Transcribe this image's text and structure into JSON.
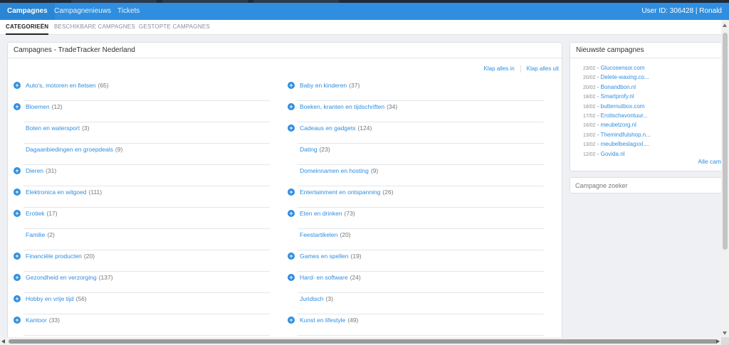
{
  "topnav": {
    "tabs": [
      "Campagnes",
      "Campagnenieuws",
      "Tickets"
    ],
    "user": "User ID: 306428 | Ronald"
  },
  "subnav": {
    "tabs": [
      "CATEGORIEËN",
      "BESCHIKBARE CAMPAGNES",
      "GESTOPTE CAMPAGNES"
    ]
  },
  "main": {
    "title": "Campagnes - TradeTracker Nederland",
    "expand_all": "Klap alles in",
    "collapse_all": "Klap alles uit",
    "left_categories": [
      {
        "name": "Auto's, motoren en fietsen",
        "count": "(65)",
        "expandable": true
      },
      {
        "name": "Bloemen",
        "count": "(12)",
        "expandable": true
      },
      {
        "name": "Boten en watersport",
        "count": "(3)",
        "expandable": false
      },
      {
        "name": "Dagaanbiedingen en groepdeals",
        "count": "(9)",
        "expandable": false
      },
      {
        "name": "Dieren",
        "count": "(31)",
        "expandable": true
      },
      {
        "name": "Elektronica en witgoed",
        "count": "(111)",
        "expandable": true
      },
      {
        "name": "Erotiek",
        "count": "(17)",
        "expandable": true
      },
      {
        "name": "Familie",
        "count": "(2)",
        "expandable": false
      },
      {
        "name": "Financiële producten",
        "count": "(20)",
        "expandable": true
      },
      {
        "name": "Gezondheid en verzorging",
        "count": "(137)",
        "expandable": true
      },
      {
        "name": "Hobby en vrije tijd",
        "count": "(56)",
        "expandable": true
      },
      {
        "name": "Kantoor",
        "count": "(33)",
        "expandable": true
      }
    ],
    "right_categories": [
      {
        "name": "Baby en kinderen",
        "count": "(37)",
        "expandable": true
      },
      {
        "name": "Boeken, kranten en tijdschriften",
        "count": "(34)",
        "expandable": true
      },
      {
        "name": "Cadeaus en gadgets",
        "count": "(124)",
        "expandable": true
      },
      {
        "name": "Dating",
        "count": "(23)",
        "expandable": false
      },
      {
        "name": "Domeinnamen en hosting",
        "count": "(9)",
        "expandable": false
      },
      {
        "name": "Entertainment en ontspanning",
        "count": "(26)",
        "expandable": true
      },
      {
        "name": "Eten en drinken",
        "count": "(73)",
        "expandable": true
      },
      {
        "name": "Feestartikelen",
        "count": "(20)",
        "expandable": false
      },
      {
        "name": "Games en spellen",
        "count": "(19)",
        "expandable": true
      },
      {
        "name": "Hard- en software",
        "count": "(24)",
        "expandable": true
      },
      {
        "name": "Juridisch",
        "count": "(3)",
        "expandable": false
      },
      {
        "name": "Kunst en lifestyle",
        "count": "(49)",
        "expandable": true
      }
    ],
    "plus_icon": "plus-circle-icon",
    "accent": "#2f8ee0"
  },
  "sidebar": {
    "title": "Nieuwste campagnes",
    "items": [
      {
        "date": "23/02",
        "title": "Glucosensor.com"
      },
      {
        "date": "20/02",
        "title": "Delete-waxing.co..."
      },
      {
        "date": "20/02",
        "title": "Bonandbon.nl"
      },
      {
        "date": "18/02",
        "title": "Smartprofy.nl"
      },
      {
        "date": "18/02",
        "title": "butternutbox.com"
      },
      {
        "date": "17/02",
        "title": "Erotischavontuur..."
      },
      {
        "date": "16/02",
        "title": "meubelzorg.nl"
      },
      {
        "date": "13/02",
        "title": "Themindfulshop.n..."
      },
      {
        "date": "13/02",
        "title": "meubelbeslagxxl...."
      },
      {
        "date": "12/02",
        "title": "Govida.nl"
      }
    ],
    "all_link": "Alle cam",
    "search_placeholder": "Campagne zoeker"
  },
  "colors": {
    "topnav": "#2f8ee0",
    "link": "#2f8ee0",
    "background": "#eef0f3"
  }
}
